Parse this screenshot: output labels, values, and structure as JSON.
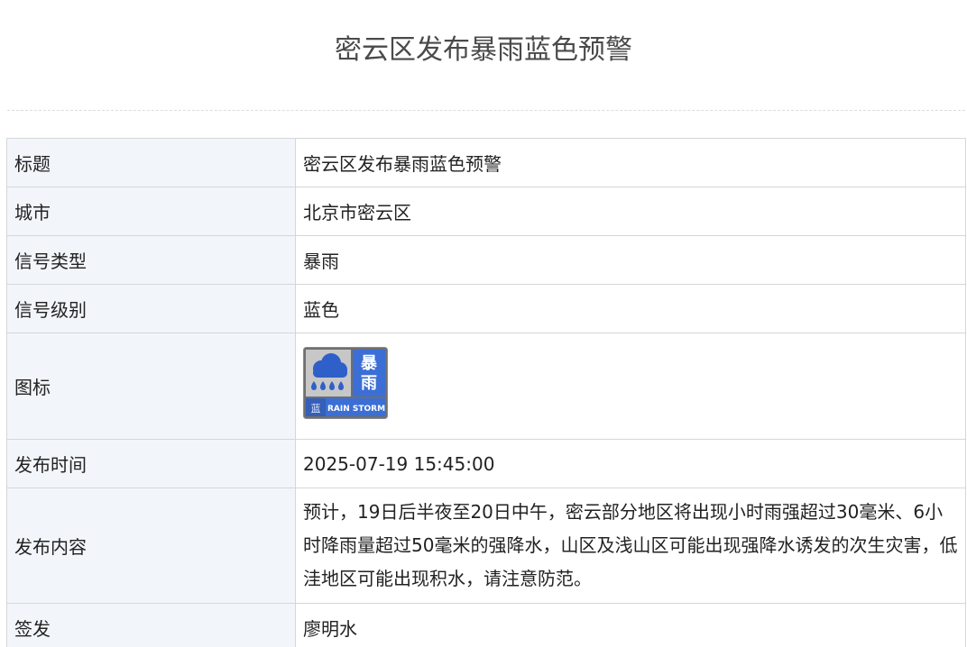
{
  "page": {
    "title": "密云区发布暴雨蓝色预警"
  },
  "table": {
    "rows": [
      {
        "label": "标题",
        "value": "密云区发布暴雨蓝色预警"
      },
      {
        "label": "城市",
        "value": "北京市密云区"
      },
      {
        "label": "信号类型",
        "value": "暴雨"
      },
      {
        "label": "信号级别",
        "value": "蓝色"
      },
      {
        "label": "图标",
        "value": ""
      },
      {
        "label": "发布时间",
        "value": "2025-07-19 15:45:00"
      },
      {
        "label": "发布内容",
        "value": "预计，19日后半夜至20日中午，密云部分地区将出现小时雨强超过30毫米、6小时降雨量超过50毫米的强降水，山区及浅山区可能出现强降水诱发的次生灾害，低洼地区可能出现积水，请注意防范。"
      },
      {
        "label": "签发",
        "value": "廖明水"
      }
    ]
  },
  "icon": {
    "name": "rainstorm-blue-warning-icon",
    "top_right_text": "暴雨",
    "bottom_left_text": "蓝",
    "bottom_right_text": "RAIN STORM",
    "colors": {
      "blue": "#3a6fd8",
      "frame": "#7a7a7a",
      "panel": "#c9c9c9",
      "cloud": "#2f5fc9"
    }
  }
}
